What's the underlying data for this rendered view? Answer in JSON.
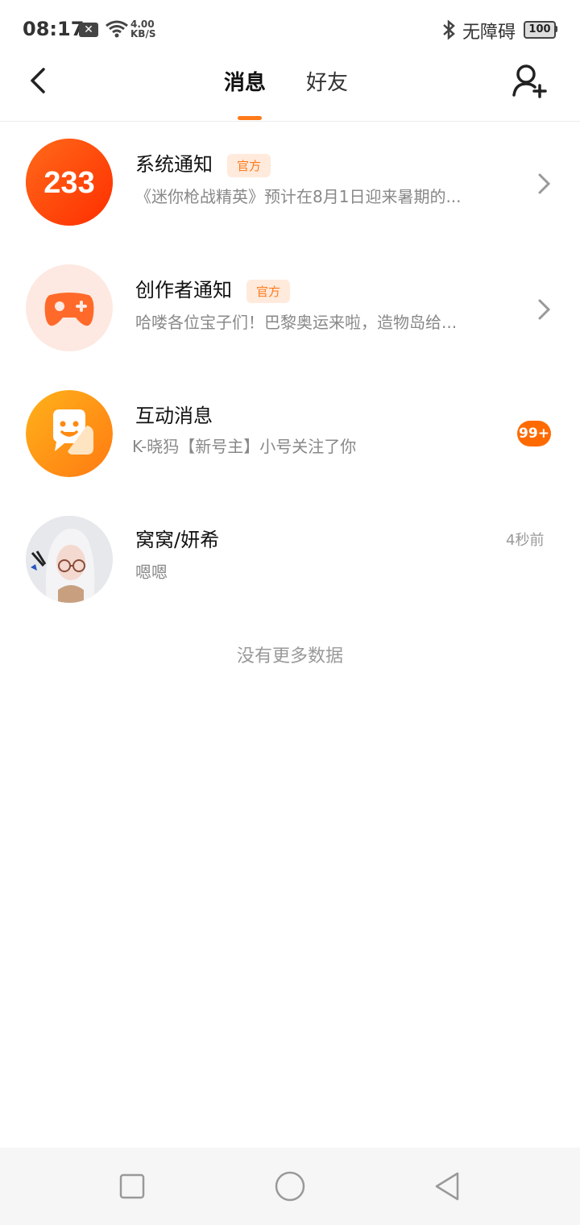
{
  "status_bar": {
    "time": "08:17",
    "x_badge": "✕",
    "net_speed_value": "4.00",
    "net_speed_unit": "KB/S",
    "accessibility": "无障碍",
    "battery": "100"
  },
  "header": {
    "tabs": [
      {
        "label": "消息",
        "active": true
      },
      {
        "label": "好友",
        "active": false
      }
    ],
    "accent_color": "#ff7a1a"
  },
  "messages": [
    {
      "title": "系统通知",
      "badge": "官方",
      "preview": "《迷你枪战精英》预计在8月1日迎来暑期的...",
      "avatar_text": "233"
    },
    {
      "title": "创作者通知",
      "badge": "官方",
      "preview": "哈喽各位宝子们！巴黎奥运来啦，造物岛给..."
    },
    {
      "title": "互动消息",
      "preview": "K-晓犸【新号主】小号关注了你",
      "count": "99+"
    },
    {
      "title": "窝窝/妍希",
      "preview": "嗯嗯",
      "time": "4秒前"
    }
  ],
  "footer_text": "没有更多数据"
}
